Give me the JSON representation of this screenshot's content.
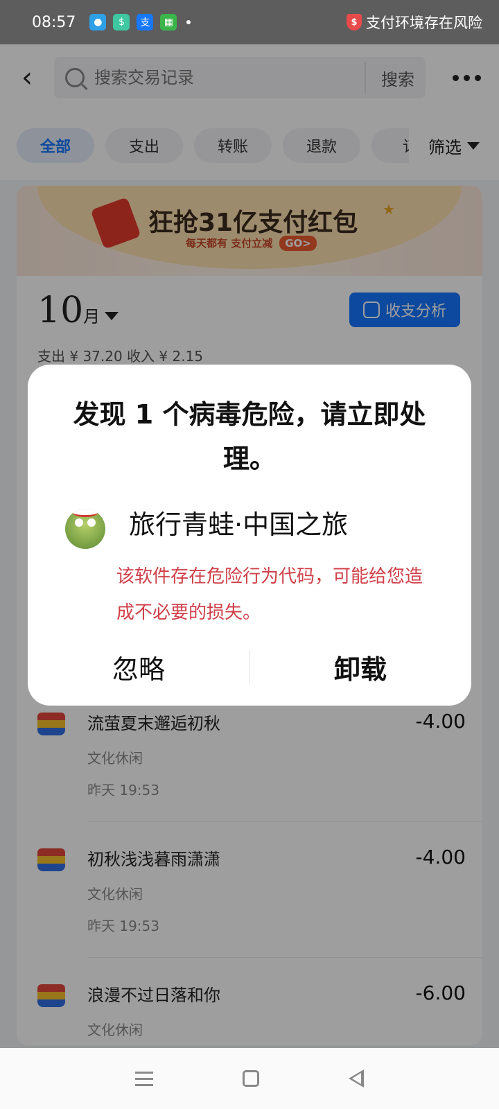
{
  "status_bar": {
    "time": "08:57",
    "notification_icons": [
      "qq-icon",
      "wallet-icon",
      "alipay-icon",
      "shop-icon"
    ],
    "risk_text": "支付环境存在风险"
  },
  "header": {
    "search_placeholder": "搜索交易记录",
    "search_button": "搜索"
  },
  "tabs": [
    {
      "label": "全部",
      "active": true
    },
    {
      "label": "支出",
      "active": false
    },
    {
      "label": "转账",
      "active": false
    },
    {
      "label": "退款",
      "active": false
    },
    {
      "label": "订",
      "active": false
    }
  ],
  "filter_label": "筛选",
  "banner": {
    "title": "狂抢31亿支付红包",
    "subtitle": "每天都有 支付立减",
    "go": "GO>"
  },
  "month": {
    "number": "10",
    "unit": "月",
    "analysis_button": "收支分析"
  },
  "summary": "支出 ¥ 37.20    收入 ¥ 2.15",
  "transactions": [
    {
      "title": "流萤夏末邂逅初秋",
      "category": "文化休闲",
      "time": "昨天 19:53",
      "amount": "-4.00"
    },
    {
      "title": "初秋浅浅暮雨潇潇",
      "category": "文化休闲",
      "time": "昨天 19:53",
      "amount": "-4.00"
    },
    {
      "title": "浪漫不过日落和你",
      "category": "文化休闲",
      "time": "",
      "amount": "-6.00"
    }
  ],
  "dialog": {
    "title": "发现 1 个病毒危险，请立即处理。",
    "app_name": "旅行青蛙·中国之旅",
    "warning": "该软件存在危险行为代码，可能给您造成不必要的损失。",
    "ignore_button": "忽略",
    "uninstall_button": "卸载"
  },
  "colors": {
    "accent": "#1677ff",
    "warning_text": "#d0404a",
    "overlay": "rgba(0,0,0,0.38)"
  }
}
